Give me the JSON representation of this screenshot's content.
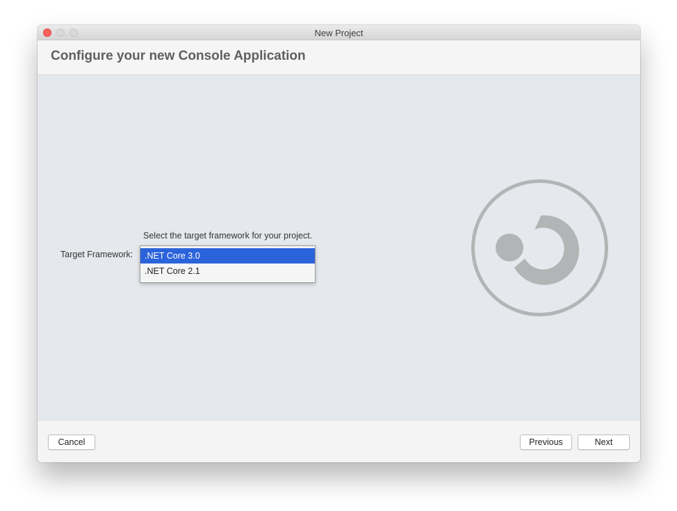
{
  "window": {
    "title": "New Project"
  },
  "header": {
    "title": "Configure your new Console Application"
  },
  "form": {
    "hint": "Select the target framework for your project.",
    "framework_label": "Target Framework:",
    "options": [
      {
        "label": ".NET Core 3.0",
        "selected": true
      },
      {
        "label": ".NET Core 2.1",
        "selected": false
      }
    ]
  },
  "logo": {
    "icon": "dotnet-logo-icon",
    "color": "#b3b4b6"
  },
  "footer": {
    "cancel_label": "Cancel",
    "previous_label": "Previous",
    "next_label": "Next"
  },
  "colors": {
    "selection": "#2b63da",
    "close_button": "#fc605c"
  }
}
